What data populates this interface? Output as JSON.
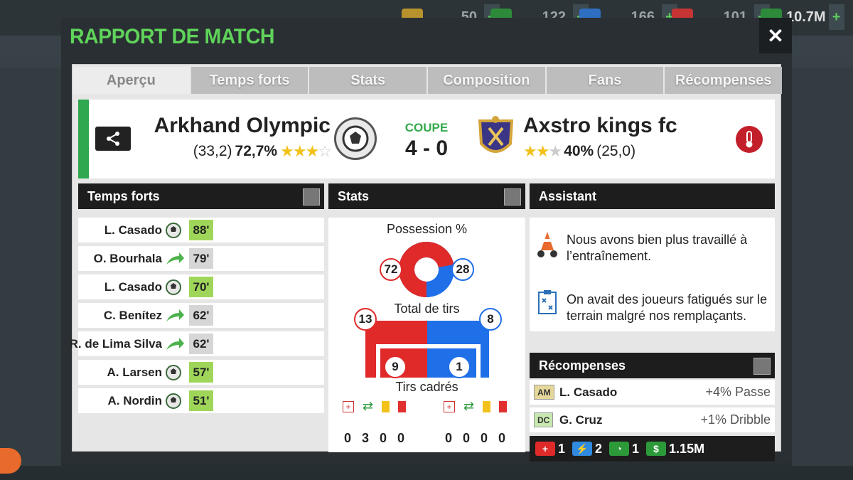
{
  "modal": {
    "title": "RAPPORT DE MATCH",
    "close_label": "✕"
  },
  "background": {
    "resources": [
      "50",
      "122",
      "166",
      "101",
      "10.7M"
    ],
    "plus_label": "+"
  },
  "tabs": [
    "Aperçu",
    "Temps forts",
    "Stats",
    "Composition",
    "Fans",
    "Récompenses"
  ],
  "match": {
    "home": {
      "name": "Arkhand Olympic",
      "rating": "(33,2)",
      "pct": "72,7%",
      "stars": 3.5
    },
    "away": {
      "name": "Axstro kings fc",
      "rating": "(25,0)",
      "pct": "40%",
      "stars": 2
    },
    "competition": "COUPE",
    "score": "4 - 0"
  },
  "highlights": {
    "title": "Temps forts",
    "rows": [
      {
        "name": "L. Casado",
        "icon": "ball-icon",
        "minute": "88'",
        "type": "goal"
      },
      {
        "name": "O. Bourhala",
        "icon": "substitution-icon",
        "minute": "79'",
        "type": "sub"
      },
      {
        "name": "L. Casado",
        "icon": "ball-icon",
        "minute": "70'",
        "type": "goal"
      },
      {
        "name": "C. Benítez",
        "icon": "substitution-icon",
        "minute": "62'",
        "type": "sub"
      },
      {
        "name": "R. de Lima Silva",
        "icon": "substitution-icon",
        "minute": "62'",
        "type": "sub"
      },
      {
        "name": "A. Larsen",
        "icon": "ball-icon",
        "minute": "57'",
        "type": "goal"
      },
      {
        "name": "A. Nordin",
        "icon": "ball-icon",
        "minute": "51'",
        "type": "goal"
      }
    ]
  },
  "stats": {
    "title": "Stats",
    "possession_label": "Possession %",
    "possession_home": "72",
    "possession_away": "28",
    "possession_home_value": 72,
    "shots_label": "Total de tirs",
    "shots_home": "13",
    "shots_away": "8",
    "on_target_label": "Tirs cadrés",
    "on_target_home": "9",
    "on_target_away": "1",
    "home_cards": [
      "0",
      "3",
      "0",
      "0"
    ],
    "away_cards": [
      "0",
      "0",
      "0",
      "0"
    ],
    "colors": {
      "home": "#e02a2a",
      "away": "#1f6fe8"
    }
  },
  "assistant": {
    "title": "Assistant",
    "notes": [
      {
        "icon": "training-cones-icon",
        "text": "Nous avons bien plus travaillé à l’entraînement."
      },
      {
        "icon": "tactics-board-icon",
        "text": "On avait des joueurs fatigués sur le terrain malgré nos remplaçants."
      }
    ]
  },
  "rewards": {
    "title": "Récompenses",
    "rows": [
      {
        "badge": "AM",
        "name": "L. Casado",
        "value": "+4% Passe"
      },
      {
        "badge": "DC",
        "name": "G. Cruz",
        "value": "+1% Dribble"
      }
    ],
    "totals": [
      {
        "icon": "medkit-icon",
        "value": "1"
      },
      {
        "icon": "energy-icon",
        "value": "2"
      },
      {
        "icon": "whistle-icon",
        "value": "1"
      },
      {
        "icon": "money-icon",
        "value": "1.15M"
      }
    ]
  }
}
